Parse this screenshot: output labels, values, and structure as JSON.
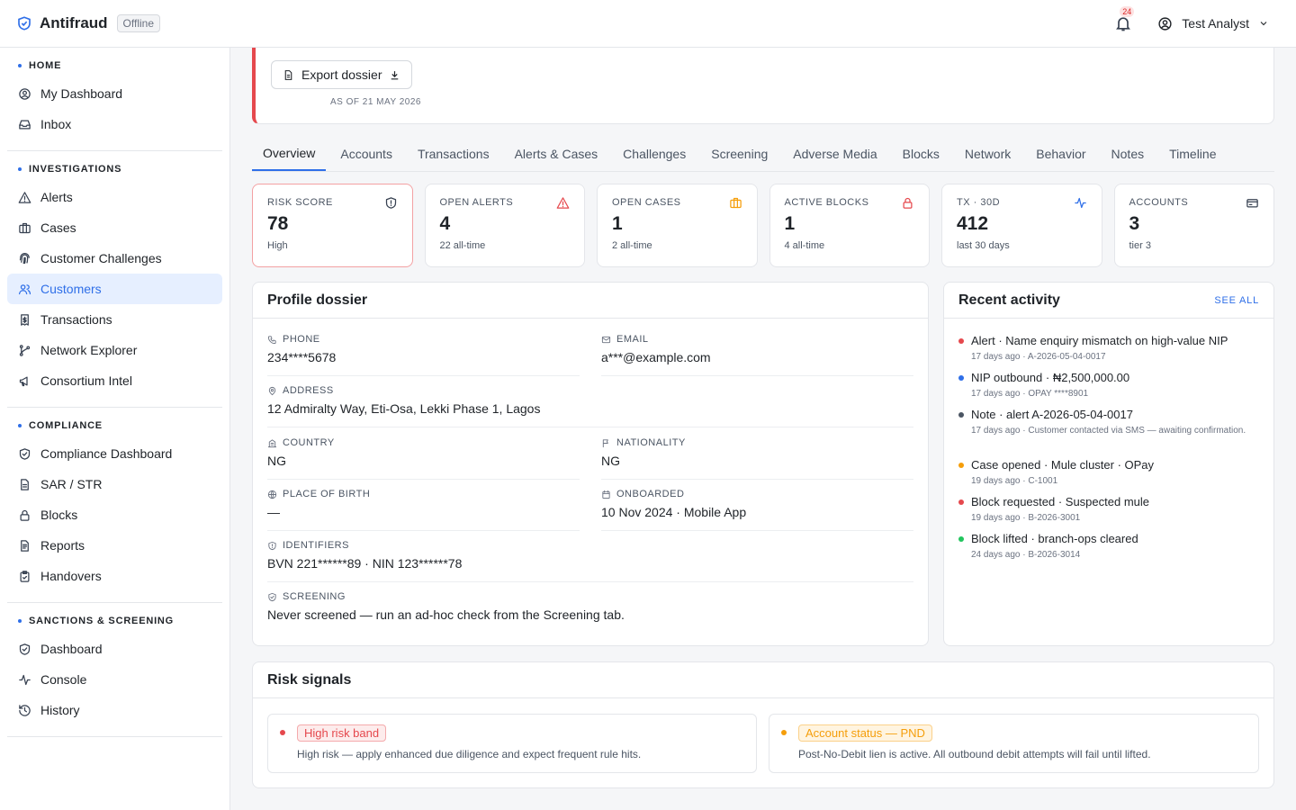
{
  "app": {
    "name": "Antifraud",
    "status": "Offline",
    "notifications_count": "24",
    "user_name": "Test Analyst"
  },
  "sidebar": {
    "sections": [
      {
        "title": "HOME",
        "items": [
          {
            "label": "My Dashboard",
            "icon": "user-circle-icon"
          },
          {
            "label": "Inbox",
            "icon": "inbox-icon"
          }
        ]
      },
      {
        "title": "INVESTIGATIONS",
        "items": [
          {
            "label": "Alerts",
            "icon": "warning-icon"
          },
          {
            "label": "Cases",
            "icon": "briefcase-icon"
          },
          {
            "label": "Customer Challenges",
            "icon": "fingerprint-icon"
          },
          {
            "label": "Customers",
            "icon": "users-icon",
            "active": true
          },
          {
            "label": "Transactions",
            "icon": "receipt-icon"
          },
          {
            "label": "Network Explorer",
            "icon": "network-icon"
          },
          {
            "label": "Consortium Intel",
            "icon": "megaphone-icon"
          }
        ]
      },
      {
        "title": "COMPLIANCE",
        "items": [
          {
            "label": "Compliance Dashboard",
            "icon": "shield-check-icon"
          },
          {
            "label": "SAR / STR",
            "icon": "document-icon"
          },
          {
            "label": "Blocks",
            "icon": "lock-icon"
          },
          {
            "label": "Reports",
            "icon": "report-icon"
          },
          {
            "label": "Handovers",
            "icon": "clipboard-check-icon"
          }
        ]
      },
      {
        "title": "SANCTIONS & SCREENING",
        "items": [
          {
            "label": "Dashboard",
            "icon": "shield-check-icon"
          },
          {
            "label": "Console",
            "icon": "activity-icon"
          },
          {
            "label": "History",
            "icon": "history-icon"
          }
        ]
      }
    ]
  },
  "header": {
    "export_label": "Export dossier",
    "as_of": "AS OF 21 MAY 2026"
  },
  "tabs": [
    "Overview",
    "Accounts",
    "Transactions",
    "Alerts & Cases",
    "Challenges",
    "Screening",
    "Adverse Media",
    "Blocks",
    "Network",
    "Behavior",
    "Notes",
    "Timeline"
  ],
  "active_tab": "Overview",
  "stats": [
    {
      "label": "RISK SCORE",
      "value": "78",
      "sub": "High",
      "icon": "shield-icon",
      "color": "#374151"
    },
    {
      "label": "OPEN ALERTS",
      "value": "4",
      "sub": "22 all-time",
      "icon": "warning-icon",
      "color": "#e5484d"
    },
    {
      "label": "OPEN CASES",
      "value": "1",
      "sub": "2 all-time",
      "icon": "briefcase-icon",
      "color": "#f59e0b"
    },
    {
      "label": "ACTIVE BLOCKS",
      "value": "1",
      "sub": "4 all-time",
      "icon": "lock-icon",
      "color": "#e5484d"
    },
    {
      "label": "TX · 30D",
      "value": "412",
      "sub": "last 30 days",
      "icon": "activity-icon",
      "color": "#2f6fe8"
    },
    {
      "label": "ACCOUNTS",
      "value": "3",
      "sub": "tier 3",
      "icon": "card-icon",
      "color": "#374151"
    }
  ],
  "profile": {
    "title": "Profile dossier",
    "fields": {
      "phone": {
        "label": "PHONE",
        "value": "234****5678"
      },
      "email": {
        "label": "EMAIL",
        "value": "a***@example.com"
      },
      "address": {
        "label": "ADDRESS",
        "value": "12 Admiralty Way, Eti-Osa, Lekki Phase 1, Lagos"
      },
      "country": {
        "label": "COUNTRY",
        "value": "NG"
      },
      "nationality": {
        "label": "NATIONALITY",
        "value": "NG"
      },
      "place_of_birth": {
        "label": "PLACE OF BIRTH",
        "value": "—"
      },
      "onboarded": {
        "label": "ONBOARDED",
        "value": "10 Nov 2024 · Mobile App"
      },
      "identifiers": {
        "label": "IDENTIFIERS",
        "value": "BVN 221******89 · NIN 123******78"
      },
      "screening": {
        "label": "SCREENING",
        "value": "Never screened — run an ad-hoc check from the Screening tab."
      }
    }
  },
  "activity": {
    "title": "Recent activity",
    "see_all": "SEE ALL",
    "items": [
      {
        "title": "Alert · Name enquiry mismatch on high-value NIP",
        "meta": "17 days ago · A-2026-05-04-0017",
        "color": "#e5484d"
      },
      {
        "title": "NIP outbound · ₦2,500,000.00",
        "meta": "17 days ago · OPAY ****8901",
        "color": "#2f6fe8"
      },
      {
        "title": "Note · alert A-2026-05-04-0017",
        "meta": "17 days ago · Customer contacted via SMS — awaiting confirmation.",
        "color": "#4b5563"
      },
      {
        "title": "Case opened · Mule cluster · OPay",
        "meta": "19 days ago · C-1001",
        "color": "#f59e0b"
      },
      {
        "title": "Block requested · Suspected mule",
        "meta": "19 days ago · B-2026-3001",
        "color": "#e5484d"
      },
      {
        "title": "Block lifted · branch-ops cleared",
        "meta": "24 days ago · B-2026-3014",
        "color": "#22c55e"
      }
    ]
  },
  "signals": {
    "title": "Risk signals",
    "items": [
      {
        "label": "High risk band",
        "desc": "High risk — apply enhanced due diligence and expect frequent rule hits.",
        "color": "#e5484d"
      },
      {
        "label": "Account status — PND",
        "desc": "Post-No-Debit lien is active. All outbound debit attempts will fail until lifted.",
        "color": "#f59e0b"
      }
    ]
  }
}
